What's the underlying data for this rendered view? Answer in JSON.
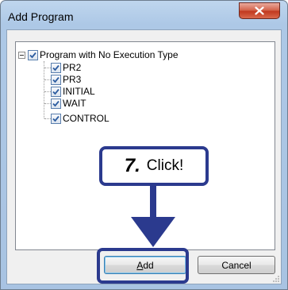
{
  "window": {
    "title": "Add Program",
    "close_glyph": "✕"
  },
  "tree": {
    "root": {
      "label": "Program with No Execution Type",
      "expanded": true,
      "checked": true
    },
    "children": [
      {
        "label": "PR2",
        "checked": true
      },
      {
        "label": "PR3",
        "checked": true
      },
      {
        "label": "INITIAL",
        "checked": true
      },
      {
        "label": "WAIT",
        "checked": true
      },
      {
        "label": "CONTROL",
        "checked": true
      }
    ]
  },
  "buttons": {
    "add_label": "Add",
    "add_mnemonic": "A",
    "cancel_label": "Cancel"
  },
  "callout": {
    "step_number": "7.",
    "text": "Click!"
  },
  "colors": {
    "annotation": "#2b3a8e",
    "title_gradient_top": "#bfd6ee",
    "close_button": "#c1391f",
    "checkbox_check": "#2c5ca0"
  }
}
